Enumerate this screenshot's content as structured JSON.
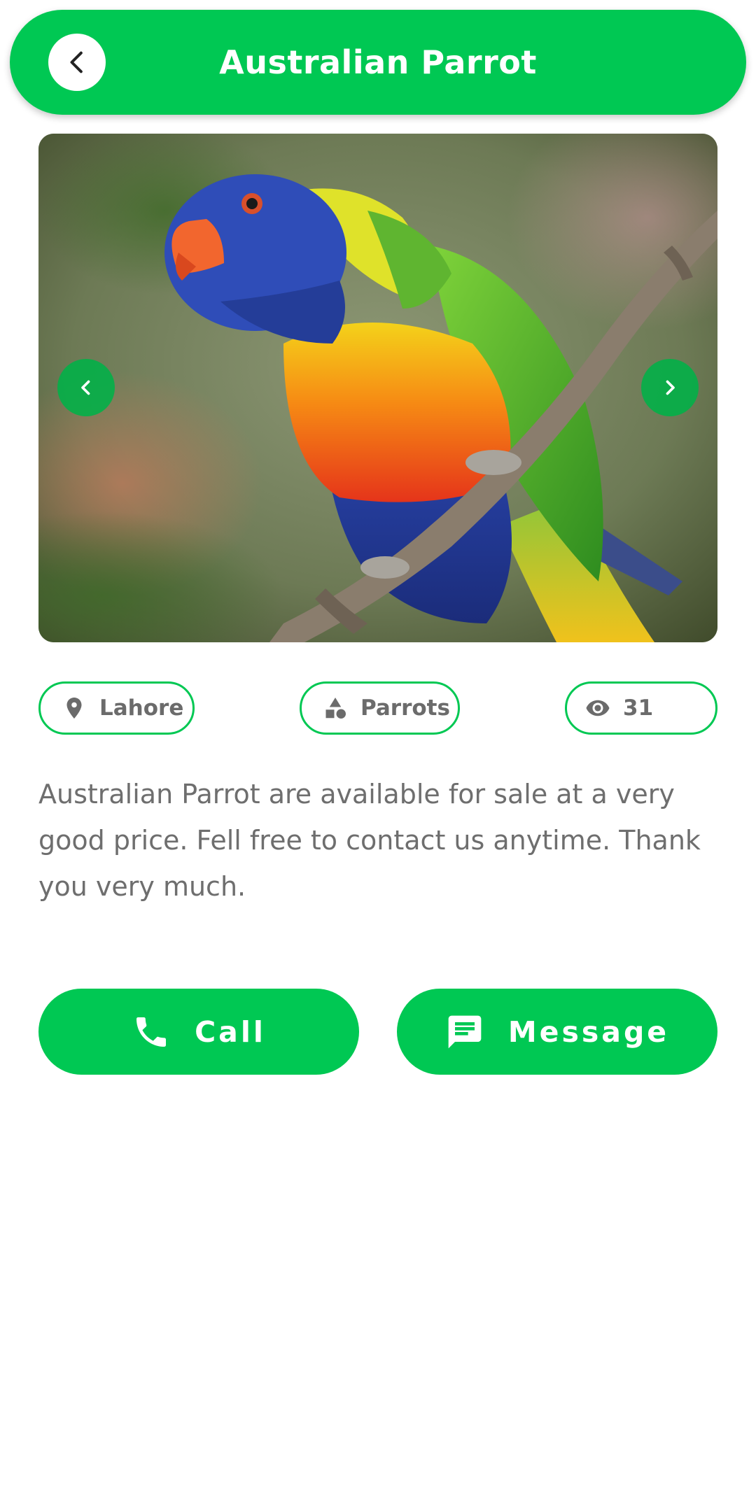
{
  "header": {
    "title": "Australian Parrot",
    "back_icon": "chevron-left-icon",
    "color": "#00c853"
  },
  "carousel": {
    "image_alt": "Rainbow lorikeet perched on a branch",
    "prev_icon": "chevron-left-icon",
    "next_icon": "chevron-right-icon"
  },
  "chips": {
    "location": {
      "icon": "location-pin-icon",
      "label": "Lahore"
    },
    "category": {
      "icon": "category-shapes-icon",
      "label": "Parrots"
    },
    "views": {
      "icon": "eye-icon",
      "label": "31"
    }
  },
  "description": "Australian Parrot are available for sale at a very good price. Fell free to contact us anytime. Thank you very much.",
  "actions": {
    "call": {
      "icon": "phone-icon",
      "label": "Call"
    },
    "message": {
      "icon": "message-icon",
      "label": "Message"
    }
  },
  "colors": {
    "accent": "#00c853",
    "text_gray": "#6e6e6e",
    "background": "#ffffff"
  }
}
